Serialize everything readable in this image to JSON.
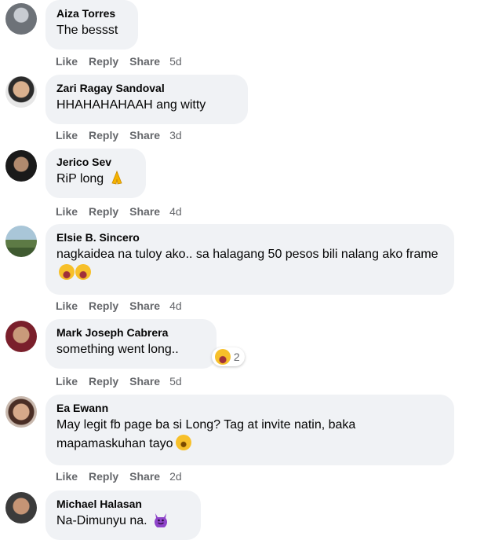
{
  "actions": {
    "like": "Like",
    "reply": "Reply",
    "share": "Share"
  },
  "comments": [
    {
      "name": "Aiza Torres",
      "text": "The bessst",
      "time": "5d"
    },
    {
      "name": "Zari Ragay Sandoval",
      "text": "HHAHAHAHAAH ang witty",
      "time": "3d"
    },
    {
      "name": "Jerico Sev",
      "text": "RiP long",
      "time": "4d"
    },
    {
      "name": "Elsie B. Sincero",
      "text": "nagkaidea na tuloy ako.. sa halagang 50 pesos bili nalang ako frame",
      "time": "4d"
    },
    {
      "name": "Mark Joseph Cabrera",
      "text": "something went long..",
      "time": "5d",
      "reaction_count": "2"
    },
    {
      "name": "Ea Ewann",
      "text": "May legit fb page ba si Long? Tag at invite natin, baka mapamaskuhan tayo",
      "time": "2d"
    },
    {
      "name": "Michael Halasan",
      "text": "Na-Dimunyu na."
    }
  ]
}
